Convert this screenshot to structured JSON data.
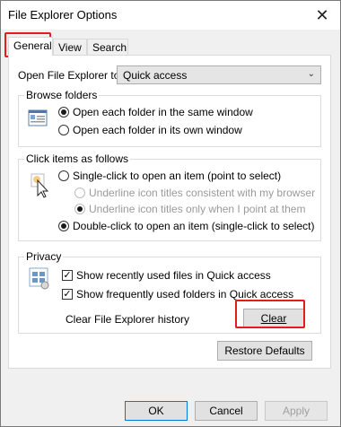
{
  "window": {
    "title": "File Explorer Options",
    "close_glyph": "✕"
  },
  "tabs": [
    {
      "label": "General"
    },
    {
      "label": "View"
    },
    {
      "label": "Search"
    }
  ],
  "open_in": {
    "label": "Open File Explorer to:",
    "value": "Quick access"
  },
  "browse": {
    "title": "Browse folders",
    "options": [
      "Open each folder in the same window",
      "Open each folder in its own window"
    ],
    "selected": 0
  },
  "click": {
    "title": "Click items as follows",
    "single": "Single-click to open an item (point to select)",
    "sub1": "Underline icon titles consistent with my browser",
    "sub2": "Underline icon titles only when I point at them",
    "double": "Double-click to open an item (single-click to select)"
  },
  "privacy": {
    "title": "Privacy",
    "recent_files": "Show recently used files in Quick access",
    "frequent_folders": "Show frequently used folders in Quick access",
    "clear_label": "Clear File Explorer history",
    "clear_button": "Clear"
  },
  "restore_button": "Restore Defaults",
  "footer": {
    "ok": "OK",
    "cancel": "Cancel",
    "apply": "Apply"
  },
  "colors": {
    "highlight": "#e51c1c",
    "default_button_border": "#0078d7"
  }
}
